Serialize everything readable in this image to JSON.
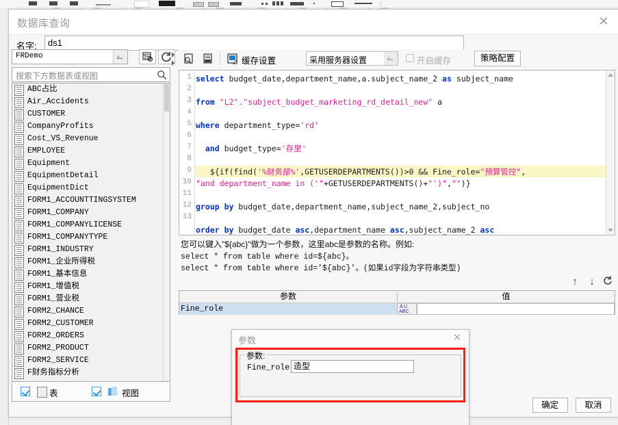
{
  "window": {
    "title": "数据库查询",
    "close_icon": "close-icon",
    "name_label": "名字:",
    "name_value": "ds1",
    "ok_label": "确定",
    "cancel_label": "取消"
  },
  "ruler": {
    "marks": [
      "100",
      "200",
      "300",
      "400",
      "500",
      "600",
      "700",
      "800",
      "900"
    ]
  },
  "left_panel": {
    "db_connection": "FRDemo",
    "db_dropdown_icon": "chevron-down-icon",
    "edit_connection_icon": "edit-datasource-icon",
    "refresh_icon": "refresh-icon",
    "search_placeholder": "搜索下方数据表或视图",
    "search_icon": "search-icon",
    "items": [
      "ABC占比",
      "Air_Accidents",
      "CUSTOMER",
      "CompanyProfits",
      "Cost_VS_Revenue",
      "EMPLOYEE",
      "Equipment",
      "EquipmentDetail",
      "EquipmentDict",
      "FORM1_ACCOUNTTINGSYSTEM",
      "FORM1_COMPANY",
      "FORM1_COMPANYLICENSE",
      "FORM1_COMPANYTYPE",
      "FORM1_INDUSTRY",
      "FORM1_企业所得税",
      "FORM1_基本信息",
      "FORM1_增值税",
      "FORM1_营业税",
      "FORM2_CHANCE",
      "FORM2_CUSTOMER",
      "FORM2_ORDERS",
      "FORM2_PRODUCT",
      "FORM2_SERVICE",
      "F财务指标分析"
    ],
    "footer": {
      "table_checked": true,
      "table_label": "表",
      "table_icon": "table-icon",
      "view_checked": true,
      "view_label": "视图",
      "view_icon": "view-icon"
    }
  },
  "sql_toolbar": {
    "preview_icon": "preview-sql-icon",
    "format_icon": "format-sql-icon",
    "cache_icon": "cache-settings-icon",
    "cache_label": "缓存设置",
    "cache_mode": "采用服务器设置",
    "cache_dropdown_icon": "chevron-down-icon",
    "enable_cache_checked": false,
    "enable_cache_label": "开启缓存",
    "policy_button": "策略配置"
  },
  "editor": {
    "line_numbers": [
      "1",
      "2",
      "3",
      "4",
      "5",
      "6",
      "7",
      "8",
      "9",
      "10",
      "11",
      "12",
      "13"
    ],
    "highlight_line": 9,
    "lines": [
      [
        {
          "t": "select",
          "c": "kw"
        },
        {
          "t": " budget_date,department_name,a.subject_name_2 ",
          "c": "plain"
        },
        {
          "t": "as",
          "c": "kw"
        },
        {
          "t": " subject_name",
          "c": "plain"
        }
      ],
      [],
      [
        {
          "t": "from",
          "c": "kw"
        },
        {
          "t": " ",
          "c": "plain"
        },
        {
          "t": "\"L2\".\"subject_budget_marketing_rd_detail_new\"",
          "c": "str"
        },
        {
          "t": " a",
          "c": "plain"
        }
      ],
      [],
      [
        {
          "t": "where",
          "c": "kw"
        },
        {
          "t": " department_type=",
          "c": "plain"
        },
        {
          "t": "'rd'",
          "c": "str"
        }
      ],
      [],
      [
        {
          "t": "  ",
          "c": "plain"
        },
        {
          "t": "and",
          "c": "kw"
        },
        {
          "t": " budget_type=",
          "c": "plain"
        },
        {
          "t": "'存里'",
          "c": "str"
        }
      ],
      [],
      [
        {
          "t": "   ${if(find(",
          "c": "plain"
        },
        {
          "t": "'%财务部%'",
          "c": "str"
        },
        {
          "t": ",GETUSERDEPARTMENTS())>0 && Fine_role=",
          "c": "plain"
        },
        {
          "t": "\"预算管控\"",
          "c": "str"
        },
        {
          "t": ",",
          "c": "plain"
        }
      ],
      [
        {
          "t": "\"and department_name in ('\"",
          "c": "str"
        },
        {
          "t": "+GETUSERDEPARTMENTS()+",
          "c": "plain"
        },
        {
          "t": "\"')\"",
          "c": "str"
        },
        {
          "t": ",",
          "c": "plain"
        },
        {
          "t": "\"\"",
          "c": "str"
        },
        {
          "t": ")}",
          "c": "plain"
        }
      ],
      [],
      [
        {
          "t": "group",
          "c": "kw"
        },
        {
          "t": " ",
          "c": "plain"
        },
        {
          "t": "by",
          "c": "kw"
        },
        {
          "t": " budget_date,department_name,subject_name_2,subject_no",
          "c": "plain"
        }
      ],
      [],
      [
        {
          "t": "order",
          "c": "kw"
        },
        {
          "t": " ",
          "c": "plain"
        },
        {
          "t": "by",
          "c": "kw"
        },
        {
          "t": " budget_date ",
          "c": "plain"
        },
        {
          "t": "asc",
          "c": "kw"
        },
        {
          "t": ",department_name ",
          "c": "plain"
        },
        {
          "t": "asc",
          "c": "kw"
        },
        {
          "t": ",subject_name_2 ",
          "c": "plain"
        },
        {
          "t": "asc",
          "c": "kw"
        }
      ]
    ],
    "scroll_up_icon": "scroll-up-icon",
    "scroll_down_icon": "scroll-down-icon"
  },
  "hint": {
    "line1": "您可以键入\"${abc}\"做为一个参数，这里abc是参数的名称。例如:",
    "line2": "select * from table where id=${abc}。",
    "line3": "select * from table where id='${abc}'。(如果id字段为字符串类型)"
  },
  "param_tools": {
    "move_up_icon": "arrow-up-icon",
    "move_down_icon": "arrow-down-icon",
    "refresh_icon": "refresh-params-icon"
  },
  "param_table": {
    "col_param": "参数",
    "col_value": "值",
    "rows": [
      {
        "name": "Fine_role",
        "type_icon": "abc-string-type-icon",
        "value": ""
      }
    ]
  },
  "param_modal": {
    "title": "参数",
    "close_icon": "close-icon",
    "group_label": "参数:",
    "field_label": "Fine_role:",
    "field_value": "造型",
    "highlight_color": "#fa1f0f"
  }
}
